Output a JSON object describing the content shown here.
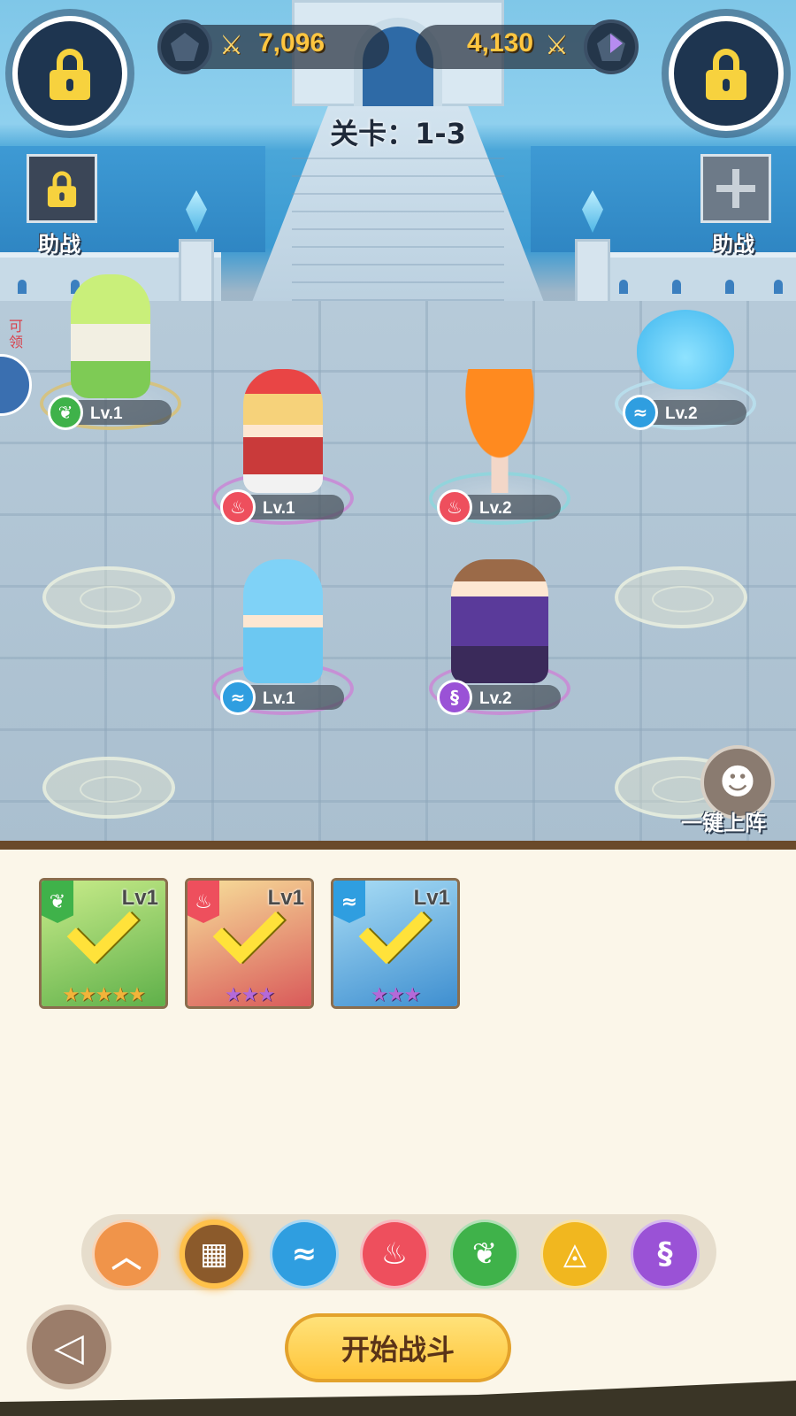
{
  "hud": {
    "player_power": "7,096",
    "enemy_power": "4,130",
    "stage_label": "关卡：1-3",
    "assist_left_label": "助战",
    "assist_right_label": "助战",
    "auto_deploy_label": "一键上阵",
    "side_text": "可领"
  },
  "units": [
    {
      "element": "nature",
      "level": "Lv.1"
    },
    {
      "element": "fire",
      "level": "Lv.1"
    },
    {
      "element": "fire",
      "level": "Lv.2"
    },
    {
      "element": "water",
      "level": "Lv.2"
    },
    {
      "element": "water",
      "level": "Lv.1"
    },
    {
      "element": "dark",
      "level": "Lv.2"
    }
  ],
  "roster": [
    {
      "element": "nature",
      "level": "Lv1",
      "stars": "★★★★★",
      "star_color": "#f2b43a",
      "selected": true
    },
    {
      "element": "fire",
      "level": "Lv1",
      "stars": "★★★",
      "star_color": "#b46ad8",
      "selected": true
    },
    {
      "element": "water",
      "level": "Lv1",
      "stars": "★★★",
      "star_color": "#b46ad8",
      "selected": true
    }
  ],
  "filters": [
    {
      "name": "collapse",
      "icon": "chevron-up-icon",
      "color": "#f0944a"
    },
    {
      "name": "all",
      "icon": "grid-icon",
      "color": "#8b5a2b",
      "selected": true
    },
    {
      "name": "water",
      "icon": "wave-icon",
      "color": "#2f9ee0"
    },
    {
      "name": "fire",
      "icon": "flame-icon",
      "color": "#ee4f5d"
    },
    {
      "name": "nature",
      "icon": "leaf-icon",
      "color": "#3fb24a"
    },
    {
      "name": "light",
      "icon": "sun-eye-icon",
      "color": "#f1b71f"
    },
    {
      "name": "dark",
      "icon": "dragon-icon",
      "color": "#9a52d6"
    }
  ],
  "actions": {
    "start_battle": "开始战斗"
  },
  "colors": {
    "nature": "#3fb24a",
    "fire": "#ee4f5d",
    "water": "#2f9ee0",
    "dark": "#9a52d6",
    "accent": "#ffc640"
  }
}
